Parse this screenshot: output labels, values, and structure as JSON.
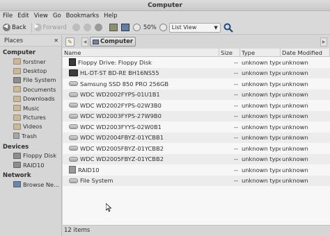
{
  "window": {
    "title": "Computer"
  },
  "menu": [
    "File",
    "Edit",
    "View",
    "Go",
    "Bookmarks",
    "Help"
  ],
  "toolbar": {
    "back_label": "Back",
    "forward_label": "Forward",
    "zoom": "50%",
    "view_mode": "List View"
  },
  "sidebar": {
    "header": "Places",
    "sections": [
      {
        "title": "Computer",
        "items": [
          {
            "label": "forstner",
            "icon": "folder"
          },
          {
            "label": "Desktop",
            "icon": "folder"
          },
          {
            "label": "File System",
            "icon": "drive"
          },
          {
            "label": "Documents",
            "icon": "folder"
          },
          {
            "label": "Downloads",
            "icon": "folder"
          },
          {
            "label": "Music",
            "icon": "folder"
          },
          {
            "label": "Pictures",
            "icon": "folder"
          },
          {
            "label": "Videos",
            "icon": "folder"
          },
          {
            "label": "Trash",
            "icon": "trash"
          }
        ]
      },
      {
        "title": "Devices",
        "items": [
          {
            "label": "Floppy Disk",
            "icon": "drive"
          },
          {
            "label": "RAID10",
            "icon": "drive"
          }
        ]
      },
      {
        "title": "Network",
        "items": [
          {
            "label": "Browse Ne...",
            "icon": "net"
          }
        ]
      }
    ]
  },
  "pathbar": {
    "current": "Computer"
  },
  "columns": {
    "name": "Name",
    "size": "Size",
    "type": "Type",
    "date": "Date Modified"
  },
  "files": [
    {
      "name": "Floppy Drive: Floppy Disk",
      "size": "--",
      "type": "unknown type",
      "date": "unknown",
      "icon": "floppy"
    },
    {
      "name": "HL-DT-ST BD-RE  BH16NS55",
      "size": "--",
      "type": "unknown type",
      "date": "unknown",
      "icon": "optical"
    },
    {
      "name": "Samsung SSD 850 PRO 256GB",
      "size": "--",
      "type": "unknown type",
      "date": "unknown",
      "icon": "hdd"
    },
    {
      "name": "WDC WD2002FYPS-01U1B1",
      "size": "--",
      "type": "unknown type",
      "date": "unknown",
      "icon": "hdd"
    },
    {
      "name": "WDC WD2002FYPS-02W3B0",
      "size": "--",
      "type": "unknown type",
      "date": "unknown",
      "icon": "hdd"
    },
    {
      "name": "WDC WD2003FYPS-27W9B0",
      "size": "--",
      "type": "unknown type",
      "date": "unknown",
      "icon": "hdd"
    },
    {
      "name": "WDC WD2003FYYS-02W0B1",
      "size": "--",
      "type": "unknown type",
      "date": "unknown",
      "icon": "hdd"
    },
    {
      "name": "WDC WD2004FBYZ-01YCBB1",
      "size": "--",
      "type": "unknown type",
      "date": "unknown",
      "icon": "hdd"
    },
    {
      "name": "WDC WD2005FBYZ-01YCBB2",
      "size": "--",
      "type": "unknown type",
      "date": "unknown",
      "icon": "hdd"
    },
    {
      "name": "WDC WD2005FBYZ-01YCBB2",
      "size": "--",
      "type": "unknown type",
      "date": "unknown",
      "icon": "hdd"
    },
    {
      "name": "RAID10",
      "size": "--",
      "type": "unknown type",
      "date": "unknown",
      "icon": "raid"
    },
    {
      "name": "File System",
      "size": "--",
      "type": "unknown type",
      "date": "unknown",
      "icon": "hdd"
    }
  ],
  "status": "12 items"
}
